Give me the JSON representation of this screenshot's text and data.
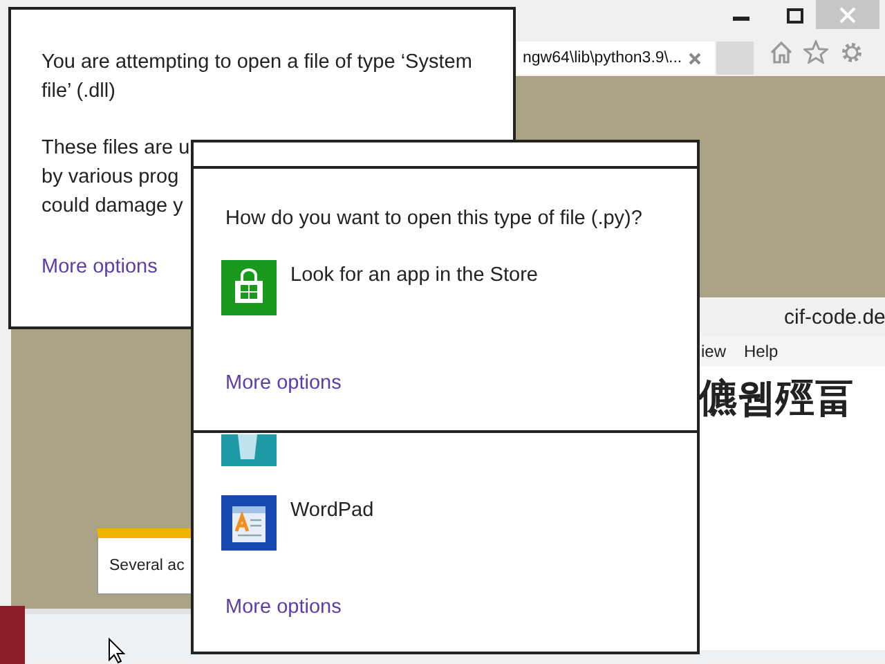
{
  "browser": {
    "tab": {
      "title": "ngw64\\lib\\python3.9\\..."
    }
  },
  "security_dialog": {
    "message": "You are attempting to open a file of type ‘System file’ (.dll)",
    "detail_lines": [
      "These files are u",
      "by various prog",
      "could damage y"
    ],
    "link": "More options"
  },
  "side_window": {
    "title": "cif-code.de",
    "menu": [
      "iew",
      "Help"
    ],
    "content": "儦웹殌畐"
  },
  "notification": {
    "text": "Several ac"
  },
  "open_with_dialog": {
    "apps": [
      {
        "kind": "notepad"
      },
      {
        "kind": "wordpad",
        "name": "WordPad"
      }
    ],
    "link": "More options"
  },
  "store_dialog": {
    "question": "How do you want to open this type of file (.py)?",
    "option": "Look for an app in the Store",
    "link": "More options"
  }
}
